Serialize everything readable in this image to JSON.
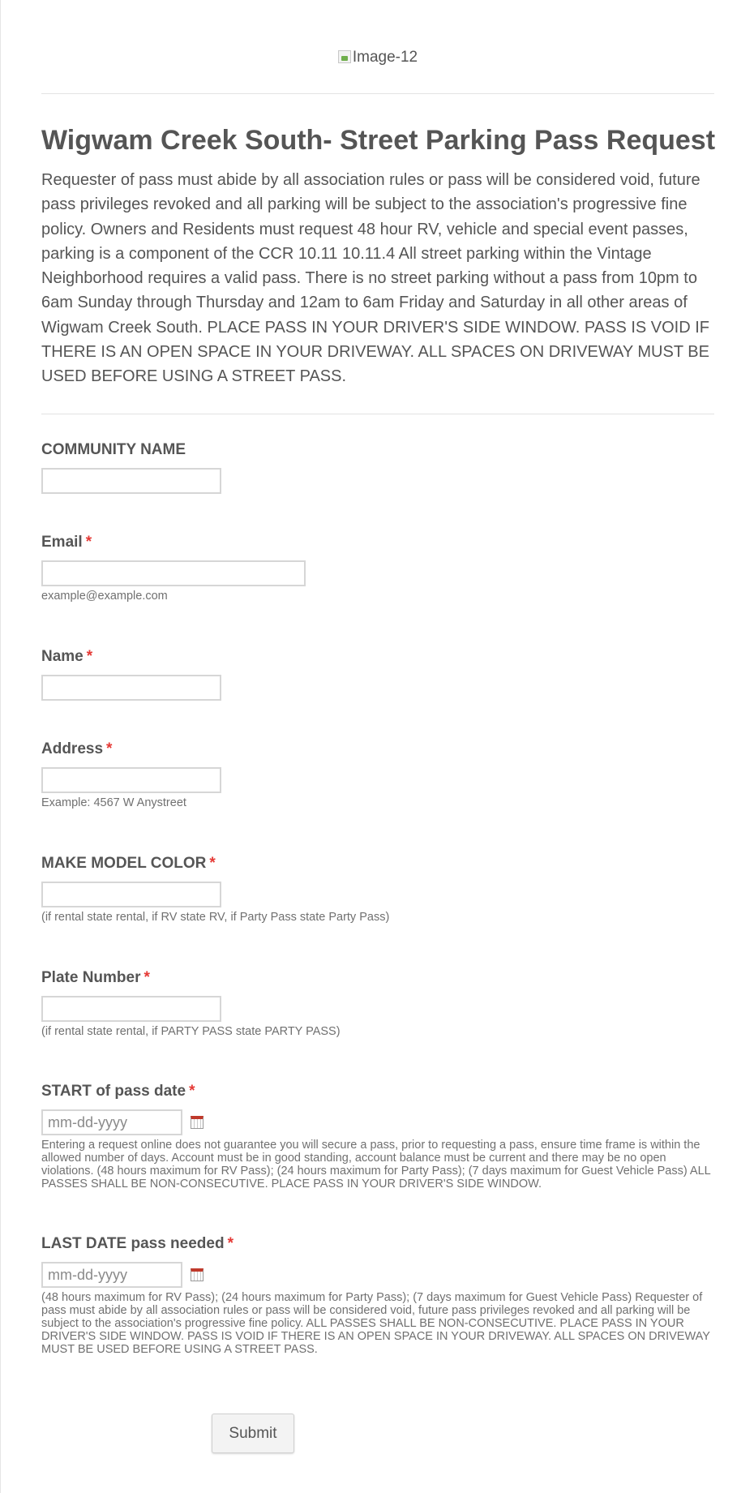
{
  "header": {
    "logo_alt": "Image-12"
  },
  "form": {
    "title": "Wigwam Creek South- Street Parking Pass Request",
    "intro": "Requester of pass must abide by all association rules or pass will be considered void, future pass privileges revoked and all parking will be subject to the association's progressive fine policy.    Owners and Residents must request 48 hour RV, vehicle and special event passes, parking is a component of the CCR 10.11 10.11.4  All street parking within the Vintage Neighborhood requires a valid pass. There is no street parking without a pass from 10pm to 6am Sunday through Thursday and 12am to 6am Friday and Saturday in all other areas of Wigwam Creek South. PLACE PASS IN YOUR DRIVER'S SIDE WINDOW. PASS IS VOID IF THERE IS AN OPEN SPACE IN YOUR DRIVEWAY.  ALL SPACES ON DRIVEWAY MUST BE USED BEFORE USING A STREET PASS.",
    "required_marker": "*",
    "fields": {
      "community": {
        "label": "COMMUNITY NAME",
        "value": ""
      },
      "email": {
        "label": "Email",
        "value": "",
        "sublabel": "example@example.com"
      },
      "name": {
        "label": "Name",
        "value": ""
      },
      "address": {
        "label": "Address",
        "value": "",
        "sublabel": "Example: 4567 W Anystreet"
      },
      "make_model": {
        "label": "MAKE MODEL COLOR",
        "value": "",
        "sublabel": "(if rental state rental, if RV state RV, if Party Pass state Party Pass)"
      },
      "plate": {
        "label": "Plate Number",
        "value": "",
        "sublabel": "(if rental state rental, if PARTY PASS state PARTY PASS)"
      },
      "start_date": {
        "label": "START of pass date",
        "placeholder": "mm-dd-yyyy",
        "sublabel": "Entering a request online does not guarantee you will secure a pass, prior to requesting a pass, ensure time frame is within the allowed number of days. Account must be in good standing, account balance must be current and there may be no open violations. (48 hours maximum for RV Pass); (24 hours maximum for Party Pass); (7 days maximum for Guest Vehicle Pass) ALL PASSES SHALL BE NON-CONSECUTIVE. PLACE PASS IN YOUR DRIVER'S SIDE WINDOW."
      },
      "last_date": {
        "label": "LAST DATE pass needed",
        "placeholder": "mm-dd-yyyy",
        "sublabel": "(48 hours maximum for RV Pass); (24 hours maximum for Party Pass); (7 days maximum for Guest Vehicle Pass)  Requester of pass must abide by all association rules or pass will be considered void, future pass privileges revoked and all parking will be subject to the association's progressive fine policy.   ALL PASSES SHALL BE NON-CONSECUTIVE. PLACE PASS IN YOUR DRIVER'S SIDE WINDOW.  PASS IS VOID IF THERE IS AN OPEN SPACE IN YOUR DRIVEWAY.  ALL SPACES ON DRIVEWAY MUST BE USED BEFORE USING A STREET PASS."
      }
    },
    "submit_label": "Submit"
  },
  "colors": {
    "required": "#e53935",
    "text": "#555555",
    "border": "#d6d6d6"
  },
  "icons": {
    "date_picker": "calendar-icon",
    "header_image": "broken-image-icon"
  }
}
